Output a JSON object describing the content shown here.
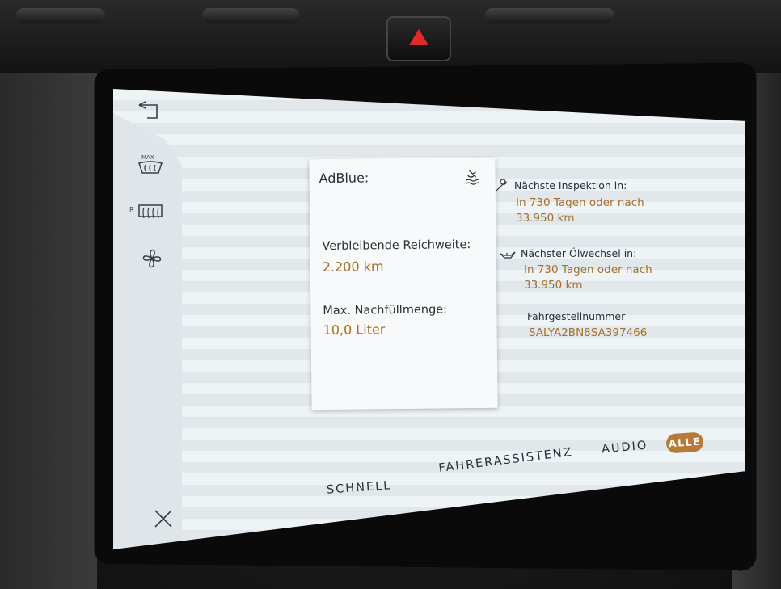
{
  "sidebar": {
    "back_icon": "back-arrow-icon",
    "max_defrost_label": "MAX",
    "rear_defrost_label": "R",
    "fan_icon": "fan-icon",
    "close_icon": "close-icon"
  },
  "adblue_card": {
    "title": "AdBlue:",
    "range_label": "Verbleibende Reichweite:",
    "range_value": "2.200 km",
    "refill_label": "Max. Nachfüllmenge:",
    "refill_value": "10,0 Liter"
  },
  "service": {
    "inspection_label": "Nächste Inspektion in:",
    "inspection_value_line1": "In 730 Tagen oder nach",
    "inspection_value_line2": "33.950 km",
    "oil_label": "Nächster Ölwechsel in:",
    "oil_value_line1": "In 730 Tagen oder nach",
    "oil_value_line2": "33.950 km",
    "vin_label": "Fahrgestellnummer",
    "vin_value": "SALYA2BN8SA397466"
  },
  "tabs": [
    {
      "label": "SCHNELL",
      "active": false
    },
    {
      "label": "FAHRERASSISTENZ",
      "active": false
    },
    {
      "label": "AUDIO",
      "active": false
    },
    {
      "label": "ALLE",
      "active": true
    }
  ],
  "colors": {
    "accent": "#b77a38",
    "value_text": "#a5702e",
    "hazard": "#e12b2b"
  }
}
